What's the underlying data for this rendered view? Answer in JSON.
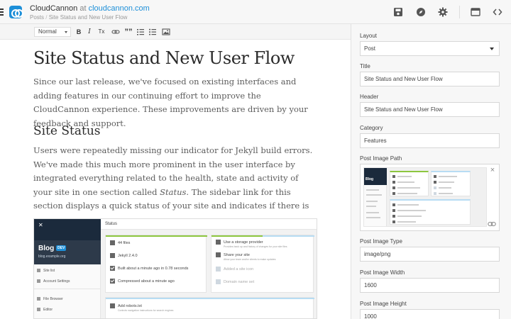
{
  "header": {
    "site_name": "CloudCannon",
    "at": "at",
    "domain": "cloudcannon.com",
    "breadcrumb_parent": "Posts",
    "breadcrumb_sep": "/",
    "breadcrumb_current": "Site Status and New User Flow"
  },
  "toolbar": {
    "format_value": "Normal",
    "bold": "B",
    "italic": "I",
    "clear_format": "Tx",
    "quote": "””"
  },
  "article": {
    "title": "Site Status and New User Flow",
    "intro": "Since our last release, we've focused on existing interfaces and adding features in our continuing effort to improve the CloudCannon experience. These improvements are driven by your feedback and support.",
    "section_heading": "Site Status",
    "section_text_before": "Users were repeatedly missing our indicator for Jekyll build errors. We've made this much more prominent in the user interface by integrated everything related to the health, state and activity of your site in one section called ",
    "section_text_em": "Status",
    "section_text_after": ". The sidebar link for this section displays a quick status of your site and indicates if there is an error."
  },
  "embedded_screenshot": {
    "blog_title": "Blog",
    "badge": "DEV",
    "blog_url": "blog.example.org",
    "side_items": [
      "Site list",
      "Account Settings",
      "File Browser",
      "Editor"
    ],
    "header": "Status",
    "status_rows": [
      "44 files",
      "Jekyll 2.4.0",
      "Built about a minute ago in 0.78 seconds",
      "Compressed about a minute ago"
    ],
    "action_rows": [
      {
        "title": "Use a storage provider",
        "sub": "Provides back up and history of changes for your site files"
      },
      {
        "title": "Share your site",
        "sub": "Allow your team and/or clients to make updates"
      },
      {
        "title": "Added a site icon",
        "sub": ""
      },
      {
        "title": "Domain name set",
        "sub": ""
      }
    ],
    "bottom_row": {
      "title": "Add robots.txt",
      "sub": "Controls navigation instructions for search engines"
    },
    "colors": {
      "green": "#8dc63f",
      "blue": "#4da3e0",
      "lightblue": "#b7dcf3"
    }
  },
  "sidebar": {
    "fields": [
      {
        "label": "Layout",
        "value": "Post",
        "type": "select"
      },
      {
        "label": "Title",
        "value": "Site Status and New User Flow",
        "type": "text"
      },
      {
        "label": "Header",
        "value": "Site Status and New User Flow",
        "type": "text"
      },
      {
        "label": "Category",
        "value": "Features",
        "type": "text"
      }
    ],
    "image_path_label": "Post Image Path",
    "image_type_label": "Post Image Type",
    "image_type_value": "image/png",
    "image_width_label": "Post Image Width",
    "image_width_value": "1600",
    "image_height_label": "Post Image Height",
    "image_height_value": "1000"
  },
  "icons": {
    "menu": "menu-icon",
    "logo": "cloudcannon-logo",
    "save": "save-icon",
    "compass": "compass-icon",
    "settings": "gear-icon",
    "browser": "browser-icon",
    "code": "code-icon",
    "link": "link-icon",
    "image": "image-icon",
    "list_ol": "ordered-list-icon",
    "list_ul": "bullet-list-icon",
    "close": "close-icon"
  }
}
